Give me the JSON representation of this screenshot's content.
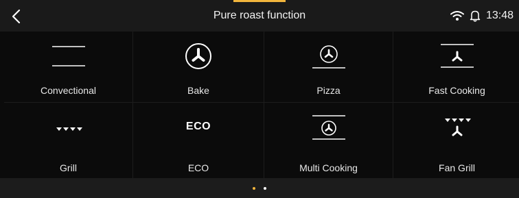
{
  "header": {
    "title": "Pure roast function",
    "time": "13:48",
    "accent_color": "#f0b43c",
    "icons": [
      "chevron-left-icon",
      "wifi-icon",
      "bell-icon"
    ]
  },
  "functions": [
    {
      "label": "Convectional",
      "icon": "convectional-icon"
    },
    {
      "label": "Bake",
      "icon": "fan-icon"
    },
    {
      "label": "Pizza",
      "icon": "pizza-icon"
    },
    {
      "label": "Fast Cooking",
      "icon": "fast-cooking-icon"
    },
    {
      "label": "Grill",
      "icon": "grill-icon"
    },
    {
      "label": "ECO",
      "icon_text": "ECO",
      "icon": "eco-icon"
    },
    {
      "label": "Multi Cooking",
      "icon": "multi-cooking-icon"
    },
    {
      "label": "Fan Grill",
      "icon": "fan-grill-icon"
    }
  ],
  "pagination": {
    "pages": 2,
    "active_page": 1,
    "active_color": "#f0b43c",
    "inactive_color": "#ffffff"
  }
}
